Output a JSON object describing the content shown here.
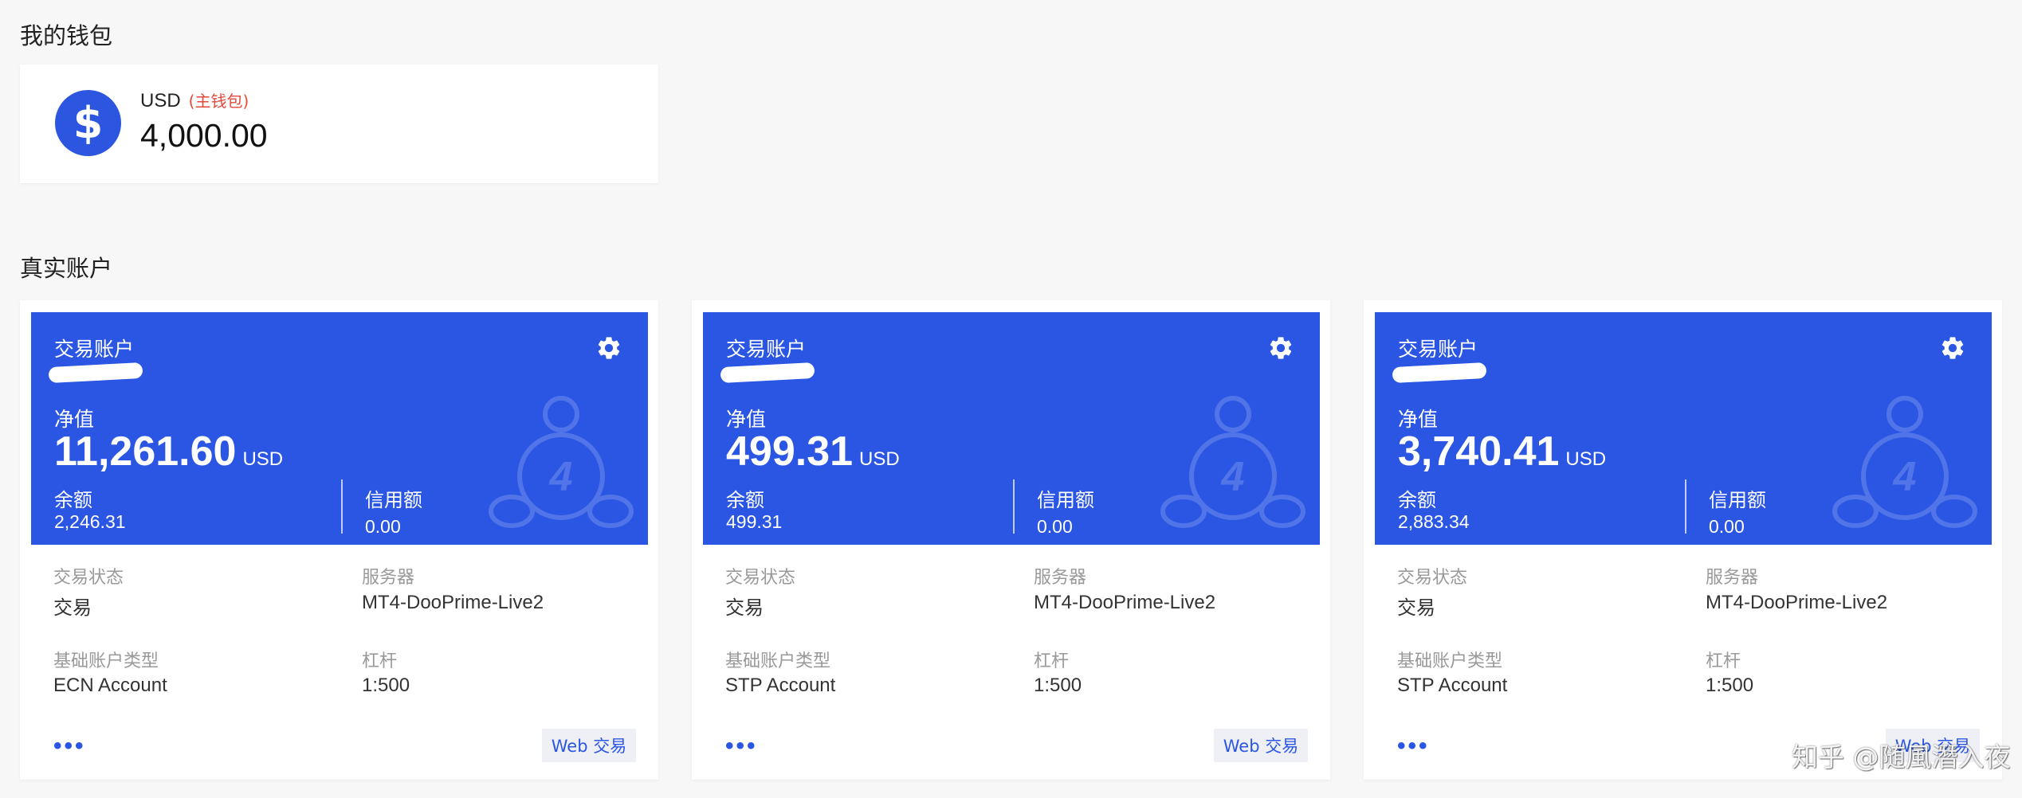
{
  "wallet": {
    "section_title": "我的钱包",
    "icon": "dollar-icon",
    "icon_glyph": "$",
    "currency": "USD",
    "tag": "(主钱包)",
    "amount": "4,000.00"
  },
  "accounts_section": {
    "title": "真实账户"
  },
  "accounts": [
    {
      "type_label": "交易账户",
      "equity_label": "净值",
      "equity_value": "11,261.60",
      "equity_unit": "USD",
      "balance_label": "余额",
      "balance_value": "2,246.31",
      "credit_label": "信用额",
      "credit_value": "0.00",
      "status_label": "交易状态",
      "status_value": "交易",
      "server_label": "服务器",
      "server_value": "MT4-DooPrime-Live2",
      "base_type_label": "基础账户类型",
      "base_type_value": "ECN Account",
      "leverage_label": "杠杆",
      "leverage_value": "1:500",
      "more": "•••",
      "web_trade": "Web 交易"
    },
    {
      "type_label": "交易账户",
      "equity_label": "净值",
      "equity_value": "499.31",
      "equity_unit": "USD",
      "balance_label": "余额",
      "balance_value": "499.31",
      "credit_label": "信用额",
      "credit_value": "0.00",
      "status_label": "交易状态",
      "status_value": "交易",
      "server_label": "服务器",
      "server_value": "MT4-DooPrime-Live2",
      "base_type_label": "基础账户类型",
      "base_type_value": "STP Account",
      "leverage_label": "杠杆",
      "leverage_value": "1:500",
      "more": "•••",
      "web_trade": "Web 交易"
    },
    {
      "type_label": "交易账户",
      "equity_label": "净值",
      "equity_value": "3,740.41",
      "equity_unit": "USD",
      "balance_label": "余额",
      "balance_value": "2,883.34",
      "credit_label": "信用额",
      "credit_value": "0.00",
      "status_label": "交易状态",
      "status_value": "交易",
      "server_label": "服务器",
      "server_value": "MT4-DooPrime-Live2",
      "base_type_label": "基础账户类型",
      "base_type_value": "STP Account",
      "leverage_label": "杠杆",
      "leverage_value": "1:500",
      "more": "•••",
      "web_trade": "Web 交易"
    }
  ],
  "watermark_text": "知乎 @随風潛入夜",
  "colors": {
    "accent": "#2a56e3",
    "tag": "#e24a3b",
    "background": "#f7f7f7"
  }
}
